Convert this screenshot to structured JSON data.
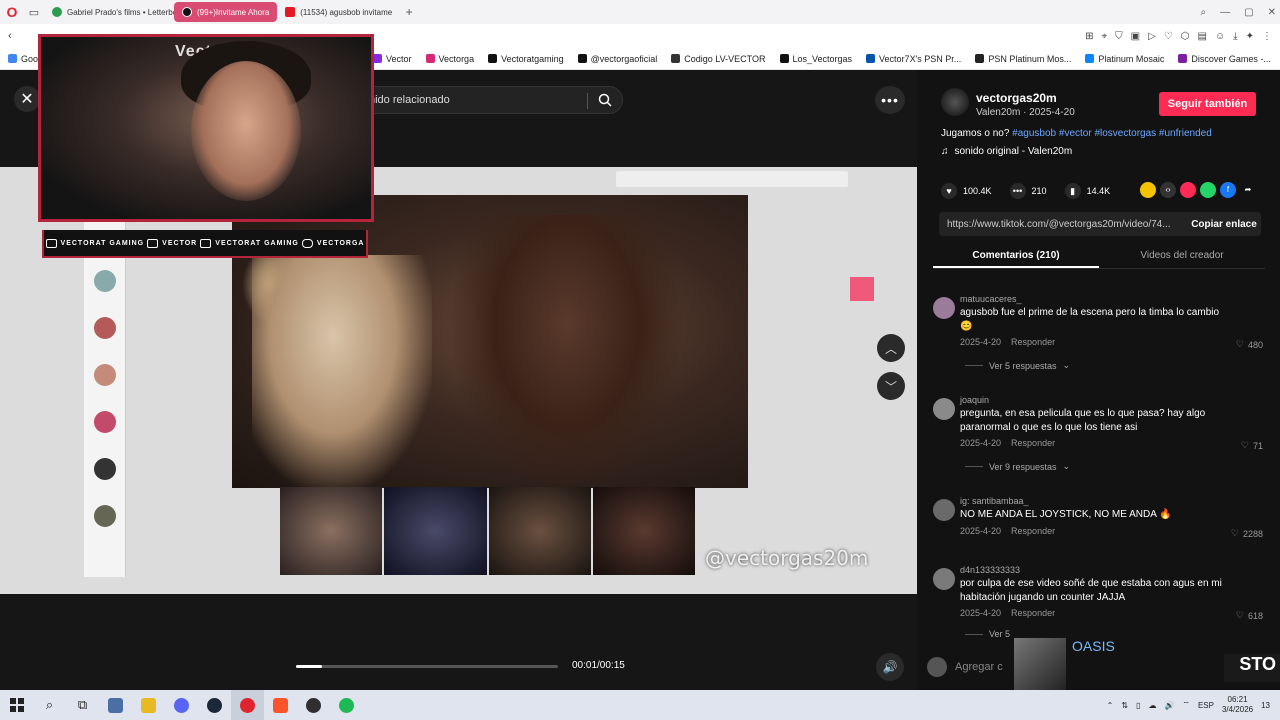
{
  "browser": {
    "tabs": [
      {
        "label": "Gabriel Prado's films • Letterboxd",
        "color": "#2e9b51"
      },
      {
        "label": "(99+)Invitame Ahora",
        "color": "#111111",
        "active": true
      },
      {
        "label": "(11534) agusbob invitame",
        "color": "#e01b24"
      }
    ],
    "add_tab": "+",
    "bookmarks": [
      {
        "label": "Goog",
        "color": "#4285f4"
      },
      {
        "label": "Vector",
        "color": "#8a2be2"
      },
      {
        "label": "Vectorga",
        "color": "#d62976"
      },
      {
        "label": "Vectoratgaming",
        "color": "#111111"
      },
      {
        "label": "@vectorgaoficial",
        "color": "#111111"
      },
      {
        "label": "Codigo LV-VECTOR",
        "color": "#333333"
      },
      {
        "label": "Los_Vectorgas",
        "color": "#111111"
      },
      {
        "label": "Vector7X's PSN Pr...",
        "color": "#0055aa"
      },
      {
        "label": "PSN Platinum Mos...",
        "color": "#222222"
      },
      {
        "label": "Platinum Mosaic",
        "color": "#0a84ff"
      },
      {
        "label": "Discover Games -...",
        "color": "#7b1fa2"
      }
    ]
  },
  "viewer": {
    "search_text": "nido relacionado",
    "watermark": "@vectorgas20m",
    "time": "00:01/00:15",
    "progress": 0.1,
    "cam_logo": "Vector"
  },
  "socials": [
    {
      "label": "VECTORAT GAMING"
    },
    {
      "label": "VECTOR"
    },
    {
      "label": "VECTORAT GAMING"
    },
    {
      "label": "VECTORGA"
    }
  ],
  "panel": {
    "username": "vectorgas20m",
    "sub": "Valen20m · 2025-4-20",
    "follow": "Seguir también",
    "desc_text": "Jugamos o no?",
    "desc_tags": "#agusbob #vector #losvectorgas #unfriended",
    "sound": "sonido original - Valen20m",
    "likes": "100.4K",
    "comments_count": "210",
    "saves": "14.4K",
    "link": "https://www.tiktok.com/@vectorgas20m/video/74...",
    "copy": "Copiar enlace",
    "tab_comments": "Comentarios (210)",
    "tab_videos": "Videos del creador"
  },
  "comments": [
    {
      "user": "matuucaceres_",
      "text": "agusbob fue el prime de la escena pero la timba lo cambio 😊",
      "date": "2025-4-20",
      "reply": "Responder",
      "likes": "480",
      "replies": "Ver 5 respuestas",
      "avatar_color": "#9b7b9a"
    },
    {
      "user": "joaquin",
      "text": "pregunta, en esa pelicula que es lo que pasa? hay algo paranormal o que es lo que los tiene asi",
      "date": "2025-4-20",
      "reply": "Responder",
      "likes": "71",
      "replies": "Ver 9 respuestas",
      "avatar_color": "#8a8a8a"
    },
    {
      "user": "ig: santibambaa_",
      "text": "NO ME ANDA EL JOYSTICK, NO ME ANDA 🔥",
      "date": "2025-4-20",
      "reply": "Responder",
      "likes": "2288",
      "replies": "",
      "avatar_color": "#6a6a6a"
    },
    {
      "user": "d4n133333333",
      "text": "por culpa de ese video soñé de que estaba con agus en mi habitación jugando un counter JAJJA",
      "date": "2025-4-20",
      "reply": "Responder",
      "likes": "618",
      "replies": "Ver 5",
      "avatar_color": "#7a7a7a"
    }
  ],
  "bottom": {
    "add_comment": "Agregar c",
    "song": "OASIS",
    "sto": "STO"
  },
  "taskbar": {
    "lang": "ESP",
    "time": "06:21",
    "date": "3/4/2026",
    "notif": "13"
  }
}
